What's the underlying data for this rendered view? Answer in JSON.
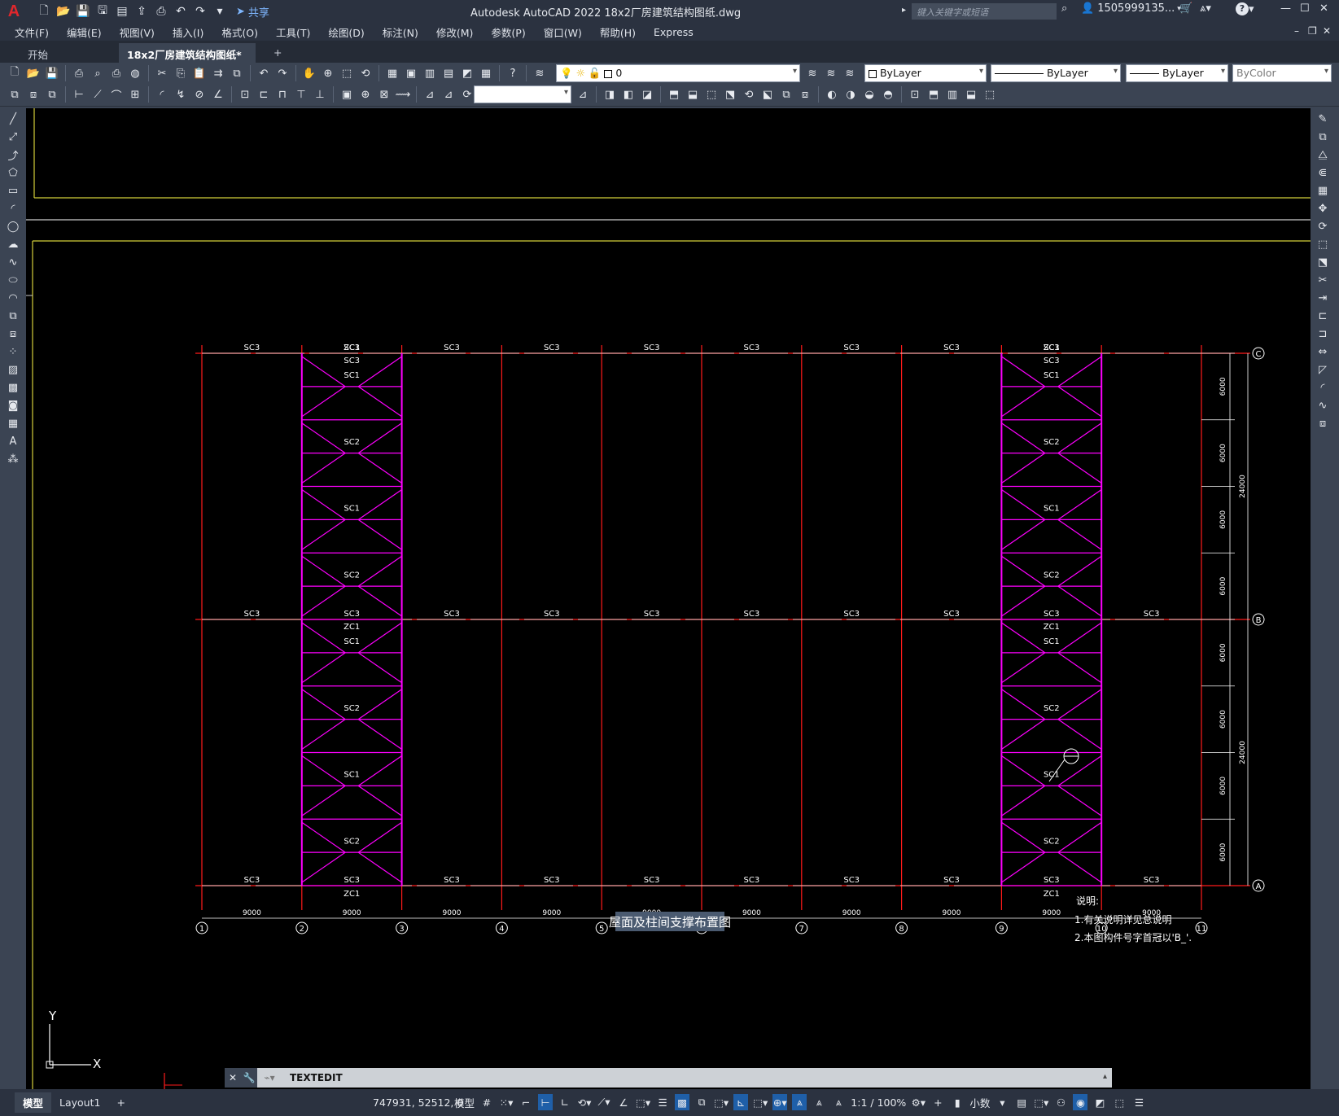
{
  "app": {
    "logo": "A",
    "title": "Autodesk AutoCAD 2022    18x2厂房建筑结构图纸.dwg",
    "share_label": "共享",
    "search_placeholder": "键入关键字或短语",
    "user": "1505999135...",
    "help": "?"
  },
  "menu": [
    "文件(F)",
    "编辑(E)",
    "视图(V)",
    "插入(I)",
    "格式(O)",
    "工具(T)",
    "绘图(D)",
    "标注(N)",
    "修改(M)",
    "参数(P)",
    "窗口(W)",
    "帮助(H)",
    "Express"
  ],
  "tabs": {
    "start": "开始",
    "active": "18x2厂房建筑结构图纸*",
    "close": "✕",
    "add": "+"
  },
  "properties": {
    "layer": "0",
    "color": "ByLayer",
    "linetype": "ByLayer",
    "lineweight": "ByLayer",
    "plotstyle": "ByColor"
  },
  "drawing": {
    "title": "屋面及柱间支撑布置图",
    "notes_header": "说明:",
    "notes": [
      "1.有关说明详见总说明",
      "2.本图构件号字首冠以'B_'."
    ],
    "axes_x": [
      "1",
      "2",
      "3",
      "4",
      "5",
      "6",
      "7",
      "8",
      "9",
      "10",
      "11"
    ],
    "axes_y": [
      "C",
      "B",
      "A"
    ],
    "bay_dim": "9000",
    "sub_dim": "6000",
    "total_dim": "24000",
    "labels": {
      "sc1": "SC1",
      "sc2": "SC2",
      "sc3": "SC3",
      "zc1": "ZC1"
    },
    "ucs_x": "X",
    "ucs_y": "Y",
    "colors": {
      "grid": "#ff1a1a",
      "brace": "#ff00ff",
      "beam": "#ffffff",
      "border": "#d4cf3a",
      "dim": "#ffffff"
    }
  },
  "command": {
    "text": "TEXTEDIT"
  },
  "status": {
    "model_tab": "模型",
    "layout_tab": "Layout1",
    "add_tab": "+",
    "coords": "747931, 52512, 0",
    "space": "模型",
    "scale": "1:1 / 100%",
    "units": "小数"
  }
}
